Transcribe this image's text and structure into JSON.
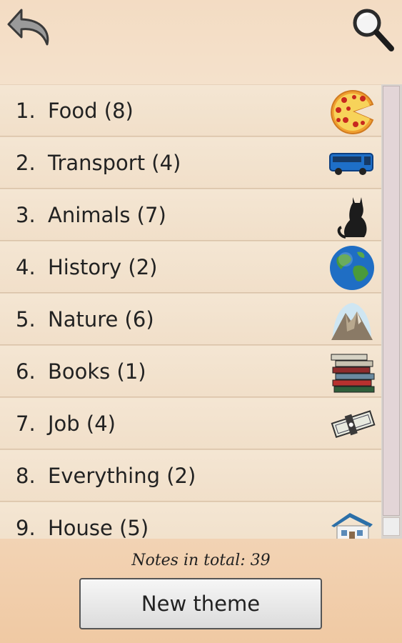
{
  "header": {
    "back_icon": "back-arrow-icon",
    "search_icon": "search-icon"
  },
  "themes": [
    {
      "number": "1.",
      "label": "Food (8)",
      "icon": "pizza-icon"
    },
    {
      "number": "2.",
      "label": "Transport (4)",
      "icon": "bus-icon"
    },
    {
      "number": "3.",
      "label": "Animals (7)",
      "icon": "cat-icon"
    },
    {
      "number": "4.",
      "label": "History (2)",
      "icon": "globe-icon"
    },
    {
      "number": "5.",
      "label": "Nature (6)",
      "icon": "mountain-icon"
    },
    {
      "number": "6.",
      "label": "Books (1)",
      "icon": "books-icon"
    },
    {
      "number": "7.",
      "label": "Job (4)",
      "icon": "money-icon"
    },
    {
      "number": "8.",
      "label": "Everything (2)",
      "icon": ""
    },
    {
      "number": "9.",
      "label": "House (5)",
      "icon": "house-icon"
    }
  ],
  "footer": {
    "notes_total": "Notes in total: 39",
    "new_theme_label": "New theme"
  },
  "colors": {
    "background_top": "#f3dcc3",
    "background_bottom": "#f0c9a3",
    "row": "#f1dfc9",
    "text": "#222222"
  }
}
